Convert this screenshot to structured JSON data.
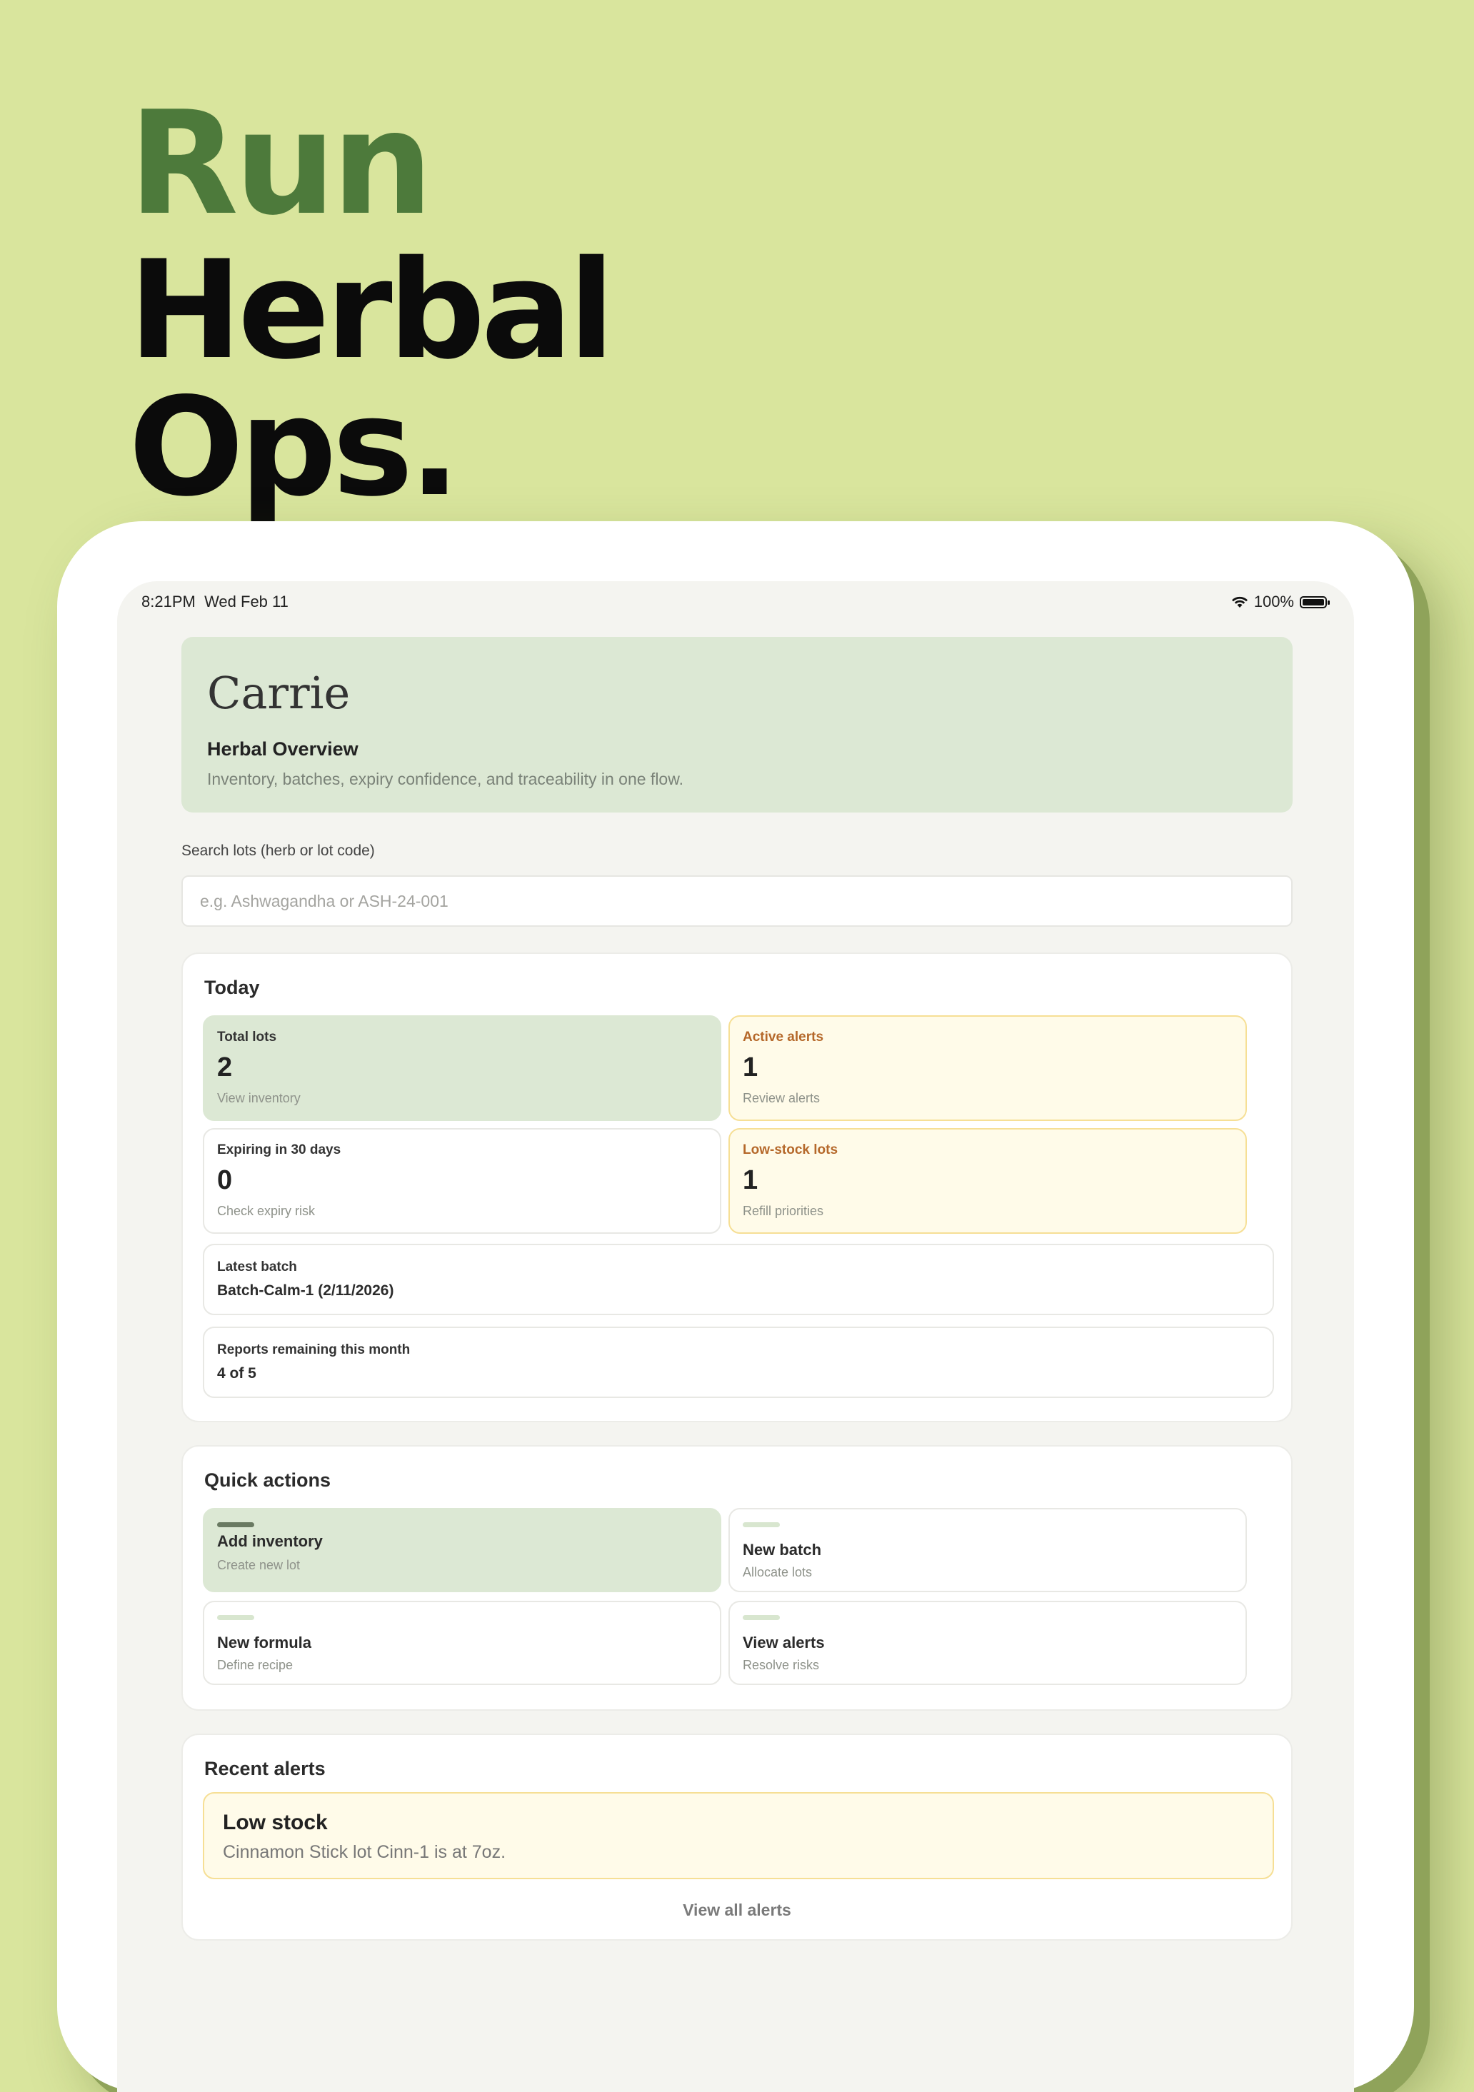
{
  "headline": {
    "line1": "Run",
    "line2": "Herbal",
    "line3": "Ops."
  },
  "status_bar": {
    "time": "8:21PM",
    "date": "Wed Feb 11",
    "battery": "100%"
  },
  "hero": {
    "name": "Carrie",
    "title": "Herbal Overview",
    "description": "Inventory, batches, expiry confidence, and traceability in one flow."
  },
  "search": {
    "label": "Search lots (herb or lot code)",
    "placeholder": "e.g. Ashwagandha or ASH-24-001",
    "value": ""
  },
  "today": {
    "title": "Today",
    "tiles": [
      {
        "label": "Total lots",
        "value": "2",
        "hint": "View inventory"
      },
      {
        "label": "Active alerts",
        "value": "1",
        "hint": "Review alerts"
      },
      {
        "label": "Expiring in 30 days",
        "value": "0",
        "hint": "Check expiry risk"
      },
      {
        "label": "Low-stock lots",
        "value": "1",
        "hint": "Refill priorities"
      }
    ],
    "latest_batch": {
      "label": "Latest batch",
      "value": "Batch-Calm-1 (2/11/2026)"
    },
    "reports": {
      "label": "Reports remaining this month",
      "value": "4 of 5"
    }
  },
  "quick_actions": {
    "title": "Quick actions",
    "items": [
      {
        "title": "Add inventory",
        "subtitle": "Create new lot"
      },
      {
        "title": "New batch",
        "subtitle": "Allocate lots"
      },
      {
        "title": "New formula",
        "subtitle": "Define recipe"
      },
      {
        "title": "View alerts",
        "subtitle": "Resolve risks"
      }
    ]
  },
  "recent_alerts": {
    "title": "Recent alerts",
    "items": [
      {
        "title": "Low stock",
        "text": "Cinnamon Stick lot Cinn-1 is at 7oz."
      }
    ],
    "view_all": "View all alerts"
  },
  "colors": {
    "background": "#d9e59d",
    "accent_green": "#4d7a3b",
    "tile_green": "#dce8d4",
    "alert_yellow": "#fffbe9",
    "alert_border": "#f6df95"
  }
}
